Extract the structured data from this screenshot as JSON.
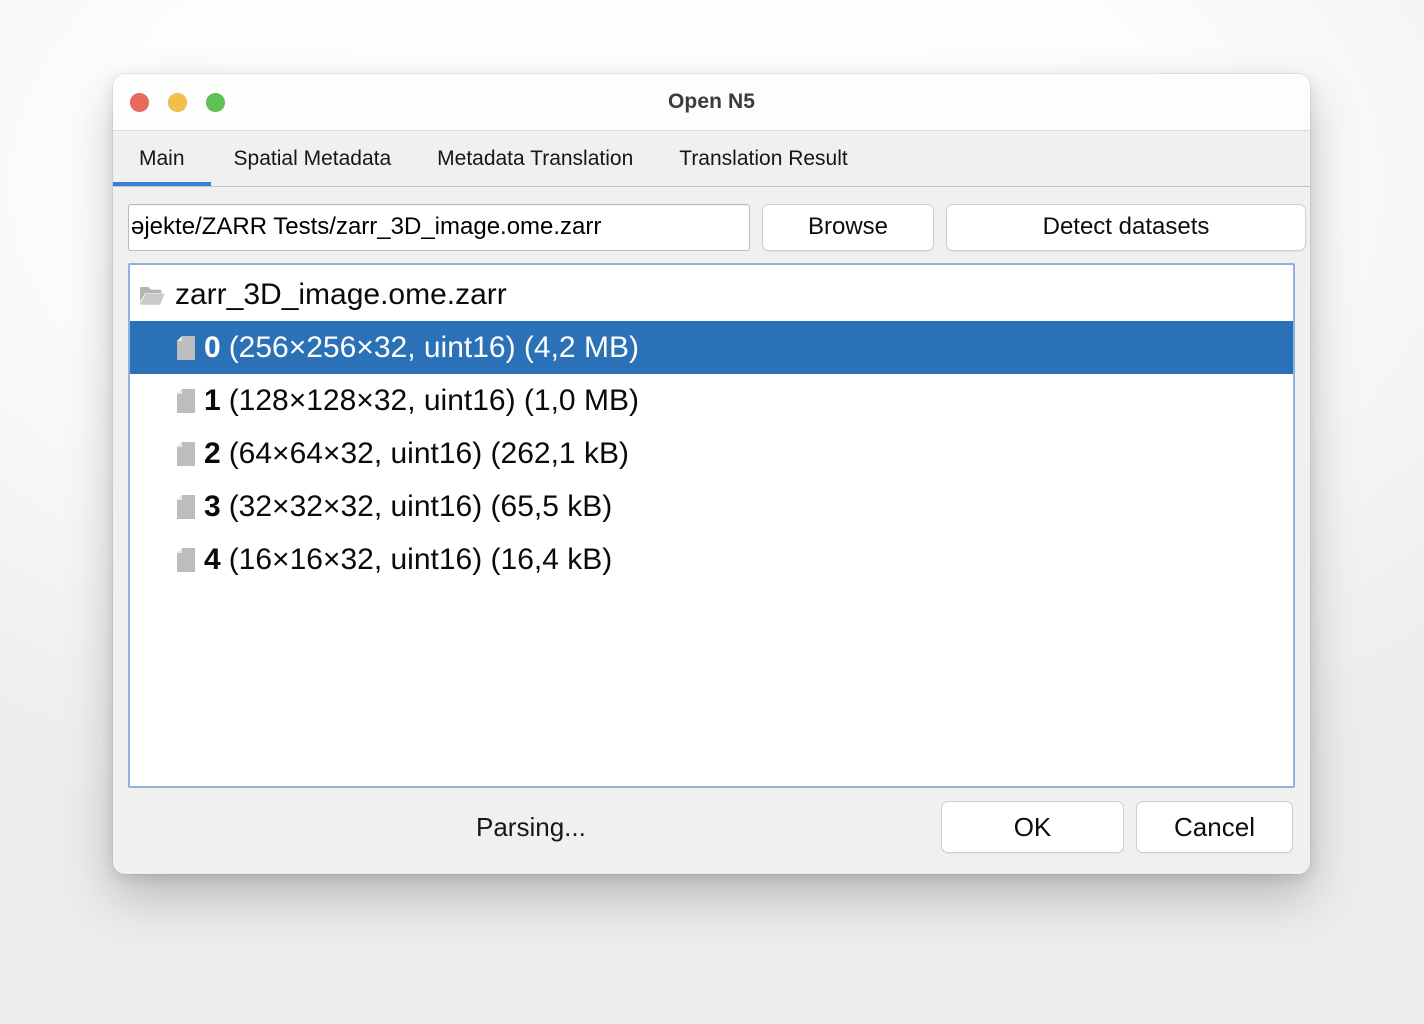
{
  "window": {
    "title": "Open N5",
    "traffic_lights": [
      {
        "name": "close",
        "color": "#e8695e"
      },
      {
        "name": "minimize",
        "color": "#f0bf4c"
      },
      {
        "name": "zoom",
        "color": "#5fc254"
      }
    ]
  },
  "tabs": [
    {
      "label": "Main",
      "active": true
    },
    {
      "label": "Spatial Metadata",
      "active": false
    },
    {
      "label": "Metadata Translation",
      "active": false
    },
    {
      "label": "Translation Result",
      "active": false
    }
  ],
  "path_row": {
    "input_value": "ǝjekte/ZARR Tests/zarr_3D_image.ome.zarr",
    "input_placeholder": "",
    "browse_label": "Browse",
    "detect_label": "Detect datasets"
  },
  "tree": {
    "root": {
      "icon": "folder-open-icon",
      "label": "zarr_3D_image.ome.zarr"
    },
    "children": [
      {
        "icon": "file-icon",
        "key": "0",
        "label": "(256×256×32, uint16) (4,2 MB)",
        "selected": true
      },
      {
        "icon": "file-icon",
        "key": "1",
        "label": "(128×128×32, uint16) (1,0 MB)",
        "selected": false
      },
      {
        "icon": "file-icon",
        "key": "2",
        "label": "(64×64×32, uint16) (262,1 kB)",
        "selected": false
      },
      {
        "icon": "file-icon",
        "key": "3",
        "label": "(32×32×32, uint16) (65,5 kB)",
        "selected": false
      },
      {
        "icon": "file-icon",
        "key": "4",
        "label": "(16×16×32, uint16) (16,4 kB)",
        "selected": false
      }
    ]
  },
  "footer": {
    "status": "Parsing...",
    "ok_label": "OK",
    "cancel_label": "Cancel"
  },
  "colors": {
    "selection_blue": "#2a71b8",
    "tab_accent": "#3b7dd8",
    "panel_border": "#8fb3dc",
    "window_chrome": "#f0f0f0"
  }
}
